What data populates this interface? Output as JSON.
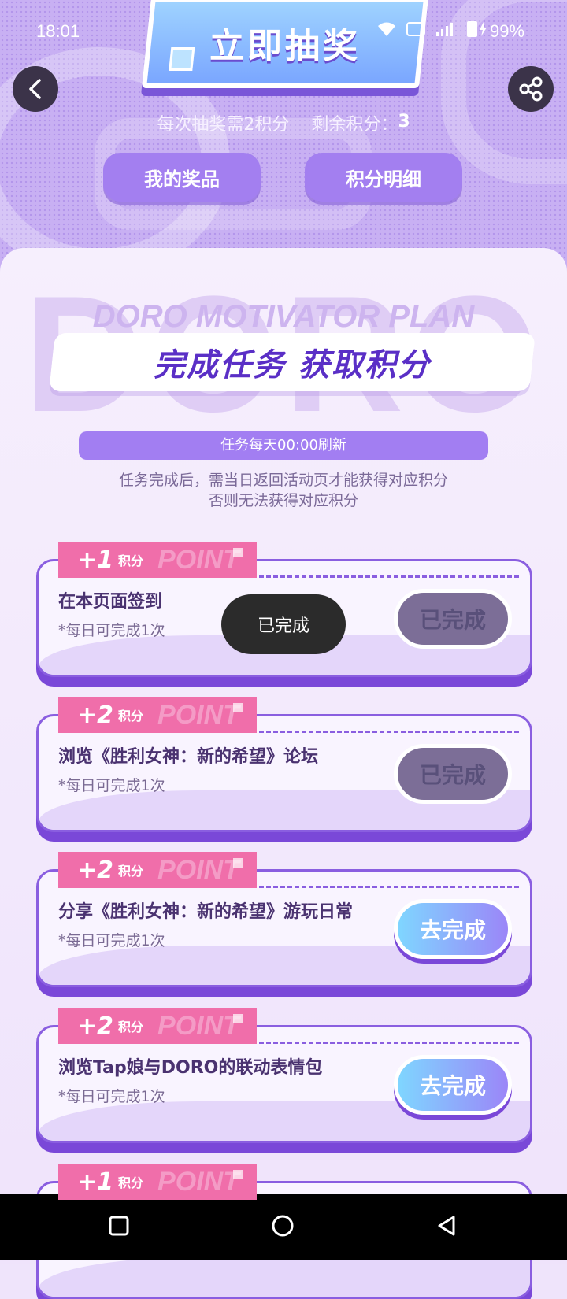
{
  "status": {
    "time": "18:01",
    "battery": "99%"
  },
  "header": {
    "title": "立即抽奖",
    "points_cost": "每次抽奖需2积分",
    "points_remaining_label": "剩余积分：",
    "points_remaining_value": "3",
    "buttons": {
      "my_prizes": "我的奖品",
      "points_detail": "积分明细"
    }
  },
  "panel": {
    "watermark": "DORO",
    "subtitle": "DORO MOTIVATOR PLAN",
    "heading": "完成任务 获取积分",
    "refresh": "任务每天00:00刷新",
    "note_line1": "任务完成后，需当日返回活动页才能获得对应积分",
    "note_line2": "否则无法获得对应积分"
  },
  "badge_word": "POINT",
  "badge_unit": "积分",
  "tasks": [
    {
      "points": "+1",
      "title": "在本页面签到",
      "subtitle": "*每日可完成1次",
      "button": "已完成",
      "state": "done"
    },
    {
      "points": "+2",
      "title": "浏览《胜利女神：新的希望》论坛",
      "subtitle": "*每日可完成1次",
      "button": "已完成",
      "state": "done"
    },
    {
      "points": "+2",
      "title": "分享《胜利女神：新的希望》游玩日常",
      "subtitle": "*每日可完成1次",
      "button": "去完成",
      "state": "todo"
    },
    {
      "points": "+2",
      "title": "浏览Tap娘与DORO的联动表情包",
      "subtitle": "*每日可完成1次",
      "button": "去完成",
      "state": "todo"
    },
    {
      "points": "+1"
    }
  ],
  "toast": "已完成",
  "colors": {
    "accent": "#8a5ee0",
    "badge": "#f06eaa",
    "heading": "#5a2fc6"
  }
}
